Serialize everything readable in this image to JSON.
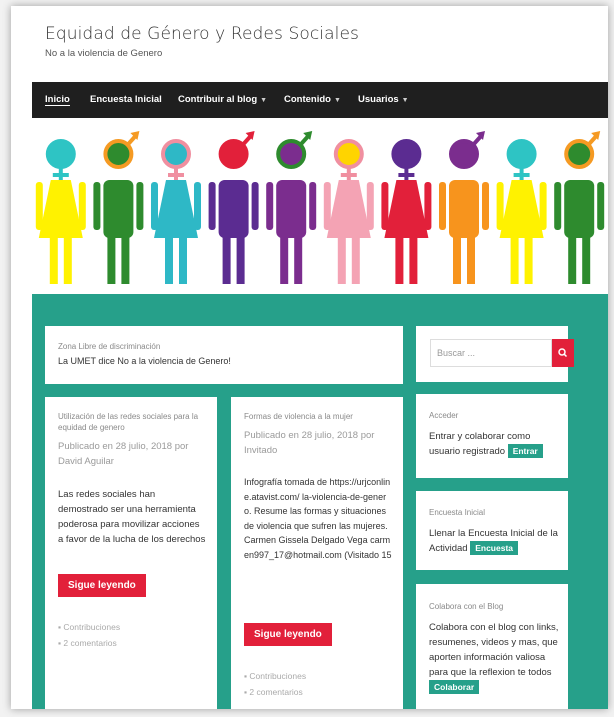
{
  "site": {
    "title": "Equidad de Género y Redes Sociales",
    "description": "No a la violencia de Genero"
  },
  "nav": {
    "items": [
      {
        "label": "Inicio"
      },
      {
        "label": "Encuesta Inicial"
      },
      {
        "label": "Contribuir al blog"
      },
      {
        "label": "Contenido"
      },
      {
        "label": "Usuarios"
      }
    ]
  },
  "banner": {
    "figures": [
      {
        "body": "#fff200",
        "head": "#2ec4c4",
        "symbol": "female",
        "symbol_color": "#2ec4c4"
      },
      {
        "body": "#2e8b2e",
        "head": "#2e8b2e",
        "symbol": "male",
        "symbol_color": "#f59a23"
      },
      {
        "body": "#2eb8c6",
        "head": "#2eb8c6",
        "symbol": "female",
        "symbol_color": "#f08fa0"
      },
      {
        "body": "#5b2c91",
        "head": "#e2203a",
        "symbol": "male",
        "symbol_color": "#e2203a"
      },
      {
        "body": "#7b2d8e",
        "head": "#7b2d8e",
        "symbol": "male",
        "symbol_color": "#2e8b2e"
      },
      {
        "body": "#f4a3b4",
        "head": "#ffd400",
        "symbol": "female",
        "symbol_color": "#f08fa0"
      },
      {
        "body": "#e2203a",
        "head": "#5b2c91",
        "symbol": "female",
        "symbol_color": "#5b2c91"
      },
      {
        "body": "#f7941d",
        "head": "#7b2d8e",
        "symbol": "male",
        "symbol_color": "#7b2d8e"
      },
      {
        "body": "#fff200",
        "head": "#2ec4c4",
        "symbol": "female",
        "symbol_color": "#2ec4c4"
      },
      {
        "body": "#2e8b2e",
        "head": "#2e8b2e",
        "symbol": "male",
        "symbol_color": "#f59a23"
      }
    ]
  },
  "zone": {
    "label": "Zona Libre de discriminación",
    "text": "La UMET dice No a la violencia de Genero!"
  },
  "post1": {
    "title": "Utilización de las redes sociales para la equidad de genero",
    "meta": "Publicado en 28 julio, 2018 por David Aguilar",
    "excerpt": "Las redes sociales han demostrado ser una herramienta poderosa para movilizar acciones a favor de la lucha de los derechos",
    "button": "Sigue leyendo",
    "category": "Contribuciones",
    "comments": "2 comentarios"
  },
  "post2": {
    "title": "Formas de violencia a la mujer",
    "meta": "Publicado en 28 julio, 2018 por Invitado",
    "excerpt": "Infografía tomada de https://urjconline.atavist.com/ la-violencia-de-genero. Resume las formas y situaciones de violencia que sufren las mujeres.Carmen Gissela Delgado Vega carmen997_17@hotmail.com (Visitado 15",
    "button": "Sigue leyendo",
    "category": "Contribuciones",
    "comments": "2 comentarios"
  },
  "sidebar": {
    "search_placeholder": "Buscar ...",
    "access": {
      "title": "Acceder",
      "text": "Entrar y colaborar como usuario registrado",
      "button": "Entrar"
    },
    "survey": {
      "title": "Encuesta Inicial",
      "text": "Llenar la Encuesta Inicial de la Actividad",
      "button": "Encuesta"
    },
    "collab": {
      "title": "Colabora con el Blog",
      "text": "Colabora con el blog con links, resumenes, videos y mas, que aporten información valiosa para que la reflexion te todos",
      "button": "Colaborar"
    }
  },
  "colors": {
    "accent": "#26a08a",
    "button_red": "#e2203a",
    "nav_bg": "#1f1f1f"
  },
  "icons": {
    "search": "magnifier-icon",
    "category": "folder-icon",
    "comments": "comment-icon"
  }
}
